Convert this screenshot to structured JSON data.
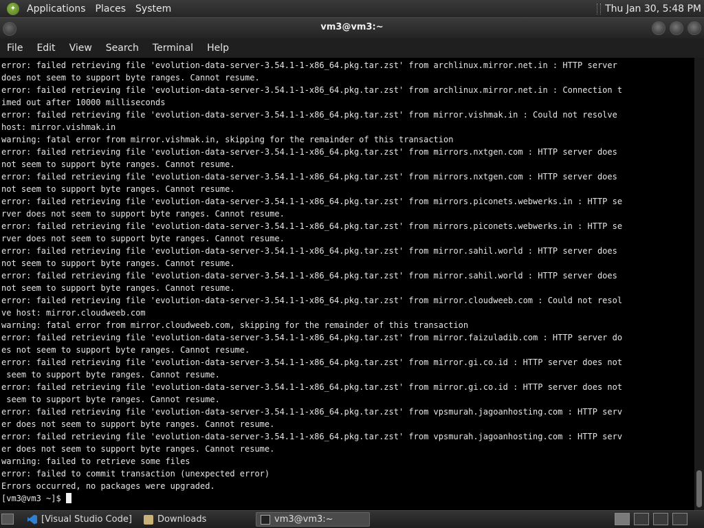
{
  "top_panel": {
    "menus": [
      "Applications",
      "Places",
      "System"
    ],
    "clock": "Thu Jan 30,  5:48 PM"
  },
  "window": {
    "title": "vm3@vm3:~"
  },
  "menubar": {
    "items": [
      "File",
      "Edit",
      "View",
      "Search",
      "Terminal",
      "Help"
    ]
  },
  "terminal": {
    "lines": [
      "error: failed retrieving file 'evolution-data-server-3.54.1-1-x86_64.pkg.tar.zst' from archlinux.mirror.net.in : HTTP server",
      "does not seem to support byte ranges. Cannot resume.",
      "error: failed retrieving file 'evolution-data-server-3.54.1-1-x86_64.pkg.tar.zst' from archlinux.mirror.net.in : Connection t",
      "imed out after 10000 milliseconds",
      "error: failed retrieving file 'evolution-data-server-3.54.1-1-x86_64.pkg.tar.zst' from mirror.vishmak.in : Could not resolve",
      "host: mirror.vishmak.in",
      "warning: fatal error from mirror.vishmak.in, skipping for the remainder of this transaction",
      "error: failed retrieving file 'evolution-data-server-3.54.1-1-x86_64.pkg.tar.zst' from mirrors.nxtgen.com : HTTP server does",
      "not seem to support byte ranges. Cannot resume.",
      "error: failed retrieving file 'evolution-data-server-3.54.1-1-x86_64.pkg.tar.zst' from mirrors.nxtgen.com : HTTP server does",
      "not seem to support byte ranges. Cannot resume.",
      "error: failed retrieving file 'evolution-data-server-3.54.1-1-x86_64.pkg.tar.zst' from mirrors.piconets.webwerks.in : HTTP se",
      "rver does not seem to support byte ranges. Cannot resume.",
      "error: failed retrieving file 'evolution-data-server-3.54.1-1-x86_64.pkg.tar.zst' from mirrors.piconets.webwerks.in : HTTP se",
      "rver does not seem to support byte ranges. Cannot resume.",
      "error: failed retrieving file 'evolution-data-server-3.54.1-1-x86_64.pkg.tar.zst' from mirror.sahil.world : HTTP server does",
      "not seem to support byte ranges. Cannot resume.",
      "error: failed retrieving file 'evolution-data-server-3.54.1-1-x86_64.pkg.tar.zst' from mirror.sahil.world : HTTP server does",
      "not seem to support byte ranges. Cannot resume.",
      "error: failed retrieving file 'evolution-data-server-3.54.1-1-x86_64.pkg.tar.zst' from mirror.cloudweeb.com : Could not resol",
      "ve host: mirror.cloudweeb.com",
      "warning: fatal error from mirror.cloudweeb.com, skipping for the remainder of this transaction",
      "error: failed retrieving file 'evolution-data-server-3.54.1-1-x86_64.pkg.tar.zst' from mirror.faizuladib.com : HTTP server do",
      "es not seem to support byte ranges. Cannot resume.",
      "error: failed retrieving file 'evolution-data-server-3.54.1-1-x86_64.pkg.tar.zst' from mirror.gi.co.id : HTTP server does not",
      " seem to support byte ranges. Cannot resume.",
      "error: failed retrieving file 'evolution-data-server-3.54.1-1-x86_64.pkg.tar.zst' from mirror.gi.co.id : HTTP server does not",
      " seem to support byte ranges. Cannot resume.",
      "error: failed retrieving file 'evolution-data-server-3.54.1-1-x86_64.pkg.tar.zst' from vpsmurah.jagoanhosting.com : HTTP serv",
      "er does not seem to support byte ranges. Cannot resume.",
      "error: failed retrieving file 'evolution-data-server-3.54.1-1-x86_64.pkg.tar.zst' from vpsmurah.jagoanhosting.com : HTTP serv",
      "er does not seem to support byte ranges. Cannot resume.",
      "warning: failed to retrieve some files",
      "error: failed to commit transaction (unexpected error)",
      "Errors occurred, no packages were upgraded."
    ],
    "prompt": "[vm3@vm3 ~]$ "
  },
  "taskbar": {
    "tasks": [
      {
        "label": "[Visual Studio Code]",
        "icon": "vscode-icon"
      },
      {
        "label": "Downloads",
        "icon": "folder-icon"
      },
      {
        "label": "vm3@vm3:~",
        "icon": "terminal-icon"
      }
    ]
  }
}
